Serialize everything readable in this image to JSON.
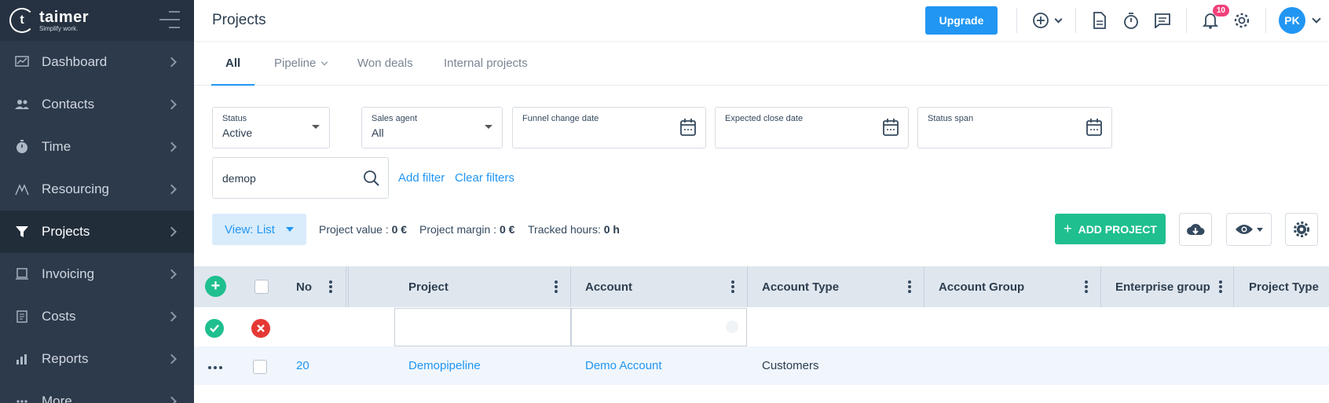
{
  "brand": {
    "name": "taimer",
    "tagline": "Simplify work."
  },
  "sidebar": {
    "items": [
      {
        "label": "Dashboard",
        "icon": "dashboard-icon"
      },
      {
        "label": "Contacts",
        "icon": "contacts-icon"
      },
      {
        "label": "Time",
        "icon": "stopwatch-icon"
      },
      {
        "label": "Resourcing",
        "icon": "resourcing-icon"
      },
      {
        "label": "Projects",
        "icon": "funnel-icon",
        "active": true
      },
      {
        "label": "Invoicing",
        "icon": "invoice-icon"
      },
      {
        "label": "Costs",
        "icon": "costs-icon"
      },
      {
        "label": "Reports",
        "icon": "bar-chart-icon"
      },
      {
        "label": "More",
        "icon": "more-icon"
      }
    ]
  },
  "header": {
    "title": "Projects",
    "upgrade_label": "Upgrade",
    "notifications_count": "10",
    "avatar_initials": "PK"
  },
  "tabs": [
    {
      "label": "All",
      "active": true
    },
    {
      "label": "Pipeline",
      "has_dropdown": true
    },
    {
      "label": "Won deals"
    },
    {
      "label": "Internal projects"
    }
  ],
  "filters": {
    "status": {
      "label": "Status",
      "value": "Active"
    },
    "sales_agent": {
      "label": "Sales agent",
      "value": "All"
    },
    "funnel_change_date": {
      "label": "Funnel change date"
    },
    "expected_close_date": {
      "label": "Expected close date"
    },
    "status_span": {
      "label": "Status span"
    },
    "search_value": "demop",
    "add_filter": "Add filter",
    "clear_filters": "Clear filters"
  },
  "toolbar": {
    "view_label": "View: List",
    "project_value_label": "Project value :",
    "project_value": "0 €",
    "project_margin_label": "Project margin :",
    "project_margin": "0 €",
    "tracked_hours_label": "Tracked hours:",
    "tracked_hours": "0 h",
    "add_project_label": "ADD PROJECT"
  },
  "table": {
    "columns": [
      "No",
      "Project",
      "Account",
      "Account Type",
      "Account Group",
      "Enterprise group",
      "Project Type"
    ],
    "rows": [
      {
        "no": "20",
        "project": "Demopipeline",
        "account": "Demo Account",
        "account_type": "Customers"
      }
    ]
  },
  "colors": {
    "sidebar_bg": "#2d3a4b",
    "accent": "#2196f3",
    "success": "#1fbf8f",
    "danger": "#e53935"
  }
}
